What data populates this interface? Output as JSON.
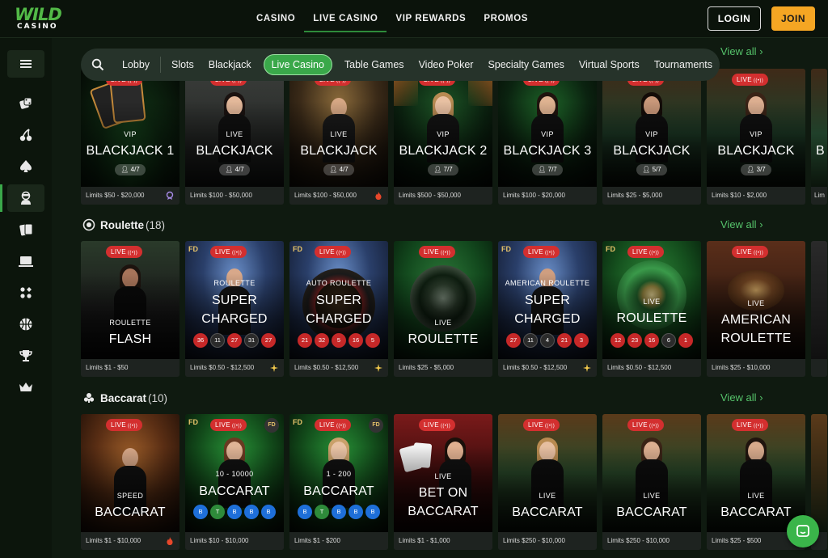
{
  "header": {
    "logo_top": "WILD",
    "logo_bottom": "CASINO",
    "nav": [
      "CASINO",
      "LIVE CASINO",
      "VIP REWARDS",
      "PROMOS"
    ],
    "active_nav": "LIVE CASINO",
    "login_label": "LOGIN",
    "join_label": "JOIN"
  },
  "sidebar": {
    "items": [
      "menu-icon",
      "dice-icon",
      "cherry-icon",
      "spade-icon",
      "dealer-icon",
      "cards-icon",
      "monitor-icon",
      "dots-icon",
      "basketball-icon",
      "trophy-icon",
      "crown-icon"
    ],
    "active": "dealer-icon"
  },
  "category_bar": {
    "items": [
      "Lobby",
      "Slots",
      "Blackjack",
      "Live Casino",
      "Table Games",
      "Video Poker",
      "Specialty Games",
      "Virtual Sports",
      "Tournaments"
    ],
    "active": "Live Casino"
  },
  "sections": {
    "blackjack": {
      "view_all": "View all",
      "cards": [
        {
          "sub": "VIP",
          "name": "BLACKJACK 1",
          "seats": "4/7",
          "limits": "Limits $50 - $20,000",
          "badge": "LIVE",
          "limit_icon": "vip-icon"
        },
        {
          "sub": "LIVE",
          "name": "BLACKJACK",
          "seats": "4/7",
          "limits": "Limits $100 - $50,000",
          "badge": "LIVE",
          "limit_icon": ""
        },
        {
          "sub": "LIVE",
          "name": "BLACKJACK",
          "seats": "4/7",
          "limits": "Limits $100 - $50,000",
          "badge": "LIVE",
          "limit_icon": "fire-icon"
        },
        {
          "sub": "VIP",
          "name": "BLACKJACK 2",
          "seats": "7/7",
          "limits": "Limits $500 - $50,000",
          "badge": "LIVE",
          "limit_icon": ""
        },
        {
          "sub": "VIP",
          "name": "BLACKJACK 3",
          "seats": "7/7",
          "limits": "Limits $100 - $20,000",
          "badge": "LIVE",
          "limit_icon": ""
        },
        {
          "sub": "VIP",
          "name": "BLACKJACK",
          "seats": "5/7",
          "limits": "Limits $25 - $5,000",
          "badge": "LIVE",
          "limit_icon": ""
        },
        {
          "sub": "VIP",
          "name": "BLACKJACK",
          "seats": "3/7",
          "limits": "Limits $10 - $2,000",
          "badge": "LIVE",
          "limit_icon": ""
        }
      ],
      "partial_name": "B",
      "partial_limits": "Lim"
    },
    "roulette": {
      "title": "Roulette",
      "count": "(18)",
      "view_all": "View all",
      "cards": [
        {
          "sub": "ROULETTE",
          "name": "FLASH",
          "name2": "",
          "limits": "Limits $1 - $50",
          "badge": "LIVE",
          "prov": "",
          "numbers": []
        },
        {
          "sub": "ROULETTE",
          "name": "SUPER",
          "name2": "CHARGED",
          "limits": "Limits $0.50 - $12,500",
          "badge": "LIVE",
          "prov": "FD",
          "numbers": [
            [
              "36",
              "red"
            ],
            [
              "11",
              "black"
            ],
            [
              "27",
              "red"
            ],
            [
              "31",
              "black"
            ],
            [
              "27",
              "red"
            ]
          ]
        },
        {
          "sub": "AUTO ROULETTE",
          "name": "SUPER",
          "name2": "CHARGED",
          "limits": "Limits $0.50 - $12,500",
          "badge": "LIVE",
          "prov": "FD",
          "numbers": [
            [
              "21",
              "red"
            ],
            [
              "32",
              "red"
            ],
            [
              "5",
              "red"
            ],
            [
              "16",
              "red"
            ],
            [
              "5",
              "red"
            ]
          ]
        },
        {
          "sub": "LIVE",
          "name": "ROULETTE",
          "name2": "",
          "limits": "Limits $25 - $5,000",
          "badge": "LIVE",
          "prov": "",
          "numbers": []
        },
        {
          "sub": "AMERICAN ROULETTE",
          "name": "SUPER",
          "name2": "CHARGED",
          "limits": "Limits $0.50 - $12,500",
          "badge": "LIVE",
          "prov": "FD",
          "numbers": [
            [
              "27",
              "red"
            ],
            [
              "11",
              "black"
            ],
            [
              "4",
              "black"
            ],
            [
              "21",
              "red"
            ],
            [
              "3",
              "red"
            ]
          ]
        },
        {
          "sub": "LIVE",
          "name": "ROULETTE",
          "name2": "",
          "limits": "Limits $0.50 - $12,500",
          "badge": "LIVE",
          "prov": "FD",
          "numbers": [
            [
              "12",
              "red"
            ],
            [
              "23",
              "red"
            ],
            [
              "16",
              "red"
            ],
            [
              "6",
              "black"
            ],
            [
              "1",
              "red"
            ]
          ]
        },
        {
          "sub": "LIVE",
          "name": "AMERICAN",
          "name2": "ROULETTE",
          "limits": "Limits $25 - $10,000",
          "badge": "LIVE",
          "prov": "",
          "numbers": []
        }
      ]
    },
    "baccarat": {
      "title": "Baccarat",
      "count": "(10)",
      "view_all": "View all",
      "cards": [
        {
          "sub": "SPEED",
          "name": "BACCARAT",
          "limits": "Limits $1 - $10,000",
          "badge": "LIVE",
          "range": "",
          "beads": []
        },
        {
          "sub": "",
          "name": "BACCARAT",
          "limits": "Limits $10 - $10,000",
          "badge": "LIVE",
          "range": "10 - 10000",
          "beads": [
            [
              "B",
              "blue"
            ],
            [
              "T",
              "green"
            ],
            [
              "B",
              "blue"
            ],
            [
              "B",
              "blue"
            ],
            [
              "B",
              "blue"
            ]
          ]
        },
        {
          "sub": "",
          "name": "BACCARAT",
          "limits": "Limits $1 - $200",
          "badge": "LIVE",
          "range": "1 - 200",
          "beads": [
            [
              "B",
              "blue"
            ],
            [
              "T",
              "green"
            ],
            [
              "B",
              "blue"
            ],
            [
              "B",
              "blue"
            ],
            [
              "B",
              "blue"
            ]
          ]
        },
        {
          "sub": "LIVE",
          "name": "BET ON",
          "name2": "BACCARAT",
          "limits": "Limits $1 - $1,000",
          "badge": "LIVE",
          "range": "",
          "beads": []
        },
        {
          "sub": "LIVE",
          "name": "BACCARAT",
          "limits": "Limits $250 - $10,000",
          "badge": "LIVE",
          "range": "",
          "beads": []
        },
        {
          "sub": "LIVE",
          "name": "BACCARAT",
          "limits": "Limits $250 - $10,000",
          "badge": "LIVE",
          "range": "",
          "beads": []
        },
        {
          "sub": "LIVE",
          "name": "BACCARAT",
          "limits": "Limits $25 - $500",
          "badge": "LIVE",
          "range": "",
          "beads": []
        }
      ]
    }
  },
  "colors": {
    "accent": "#3aa84a",
    "join": "#f5a623",
    "live_badge": "#d32f2f",
    "view_all": "#55c26a"
  }
}
